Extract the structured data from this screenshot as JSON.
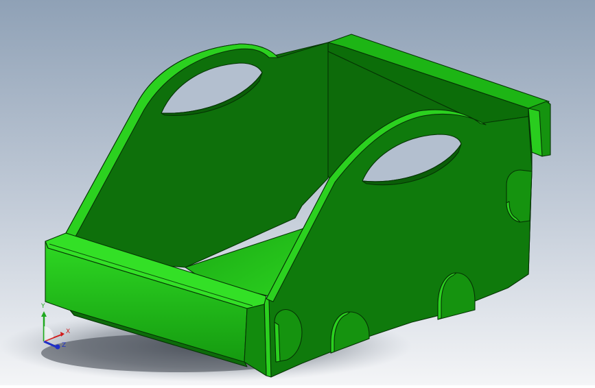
{
  "viewport": {
    "background_top": "#8fa1b6",
    "background_bottom": "#f4f5f7",
    "shadow_color": "#5d6570"
  },
  "model": {
    "part_color": "#179c12",
    "part_light": "#2bd41f",
    "part_dark": "#0b5e08",
    "part_mid": "#0f7a0c",
    "part_inner": "#0d6b0a",
    "edge_color": "#053304",
    "handle_hole_fill": "#b3bfcf"
  },
  "triad": {
    "y_label": "Y",
    "x_label": "X",
    "z_label": "Z",
    "x_color": "#d11a1a",
    "y_color": "#1fa81f",
    "z_color": "#1f2fc6"
  }
}
